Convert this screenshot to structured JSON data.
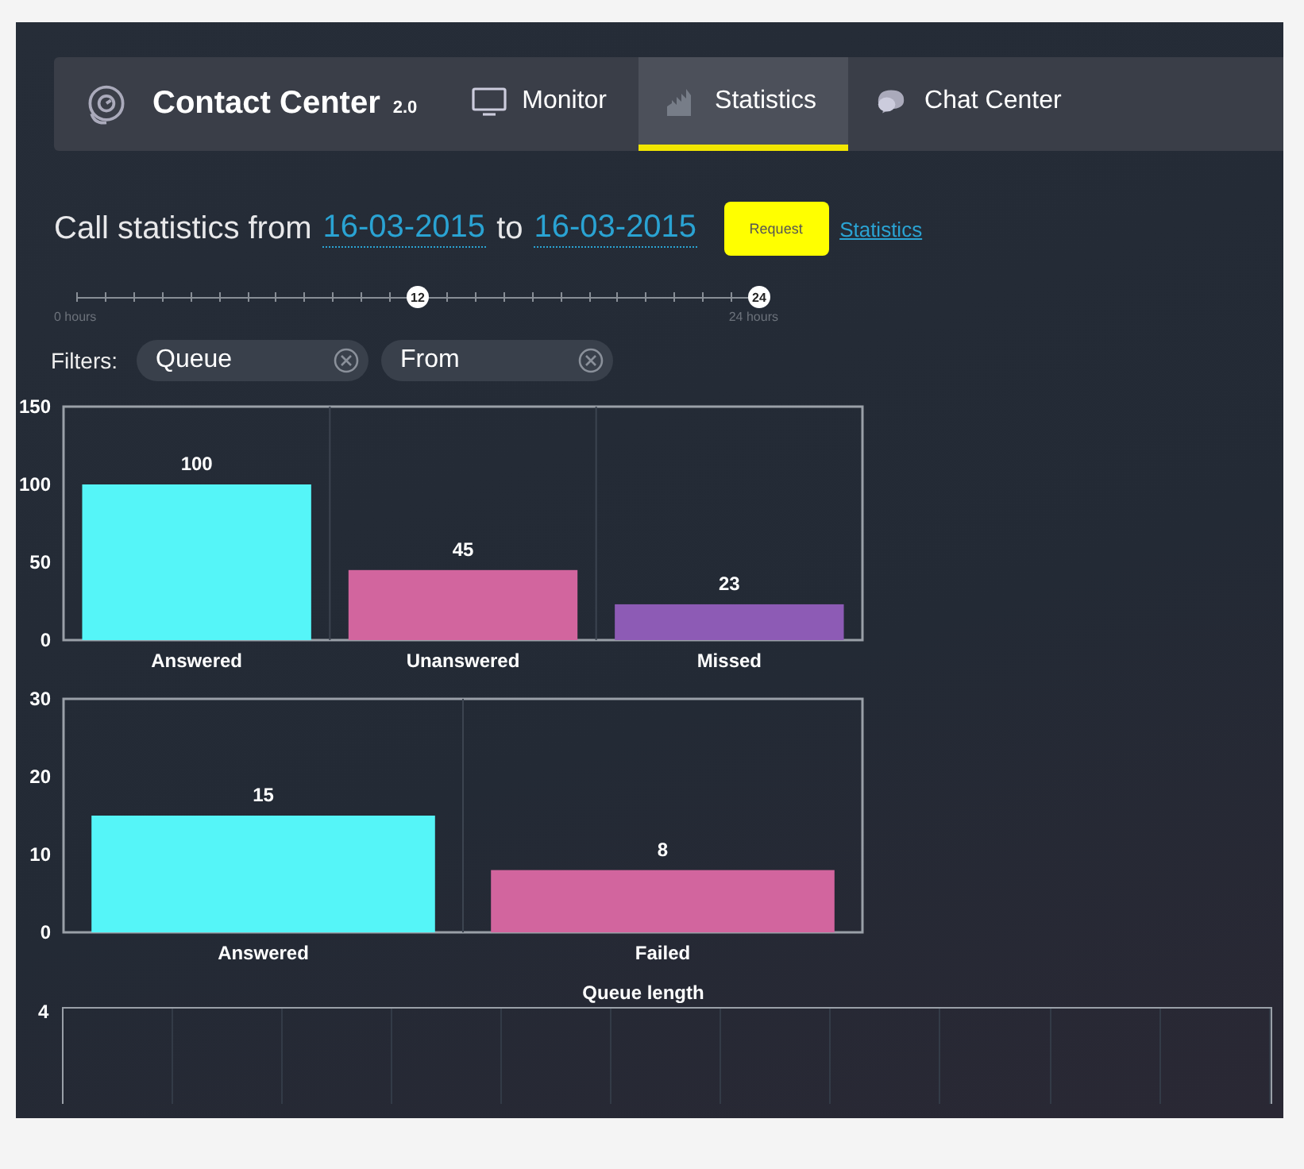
{
  "nav": {
    "brand": "Contact Center",
    "version": "2.0",
    "tabs": [
      {
        "label": "Monitor",
        "kind": "monitor",
        "selected": false
      },
      {
        "label": "Statistics",
        "kind": "bars",
        "selected": true
      },
      {
        "label": "Chat Center",
        "kind": "chat",
        "selected": false
      }
    ]
  },
  "heading": {
    "prefix": "Call statistics from",
    "from_date": "16-03-2015",
    "joiner": "to",
    "to_date": "16-03-2015",
    "request_button": "Request",
    "link": "Statistics"
  },
  "time_slider": {
    "start_label": "0 hours",
    "end_label": "24 hours",
    "handles": [
      {
        "label": "12",
        "level": 0.5
      },
      {
        "label": "24",
        "level": 1
      }
    ]
  },
  "filters": {
    "label": "Filters:",
    "chips": [
      "Queue",
      "From"
    ]
  },
  "charts": [
    {
      "chart_data": {
        "type": "bar",
        "categories": [
          "Answered",
          "Unanswered",
          "Missed"
        ],
        "stacked": true,
        "ylim": [
          0,
          150
        ],
        "yticks": [
          0,
          50,
          100,
          150
        ],
        "data_labels": true,
        "series": [
          {
            "color": "#55f5f8",
            "values": [
              100,
              null,
              null
            ]
          },
          {
            "color": "#d2659e",
            "values": [
              null,
              45,
              null
            ]
          },
          {
            "color": "#8d5bb5",
            "values": [
              null,
              null,
              23
            ]
          }
        ]
      }
    },
    {
      "chart_data": {
        "type": "bar",
        "categories": [
          "Answered",
          "Failed"
        ],
        "stacked": true,
        "ylim": [
          0,
          30
        ],
        "yticks": [
          0,
          10,
          20,
          30
        ],
        "data_labels": true,
        "series": [
          {
            "color": "#55f5f8",
            "values": [
              15,
              null
            ]
          },
          {
            "color": "#d2659e",
            "values": [
              null,
              8
            ]
          }
        ]
      }
    }
  ],
  "queue_chart": {
    "title": "Queue length",
    "top_tick": "4"
  }
}
